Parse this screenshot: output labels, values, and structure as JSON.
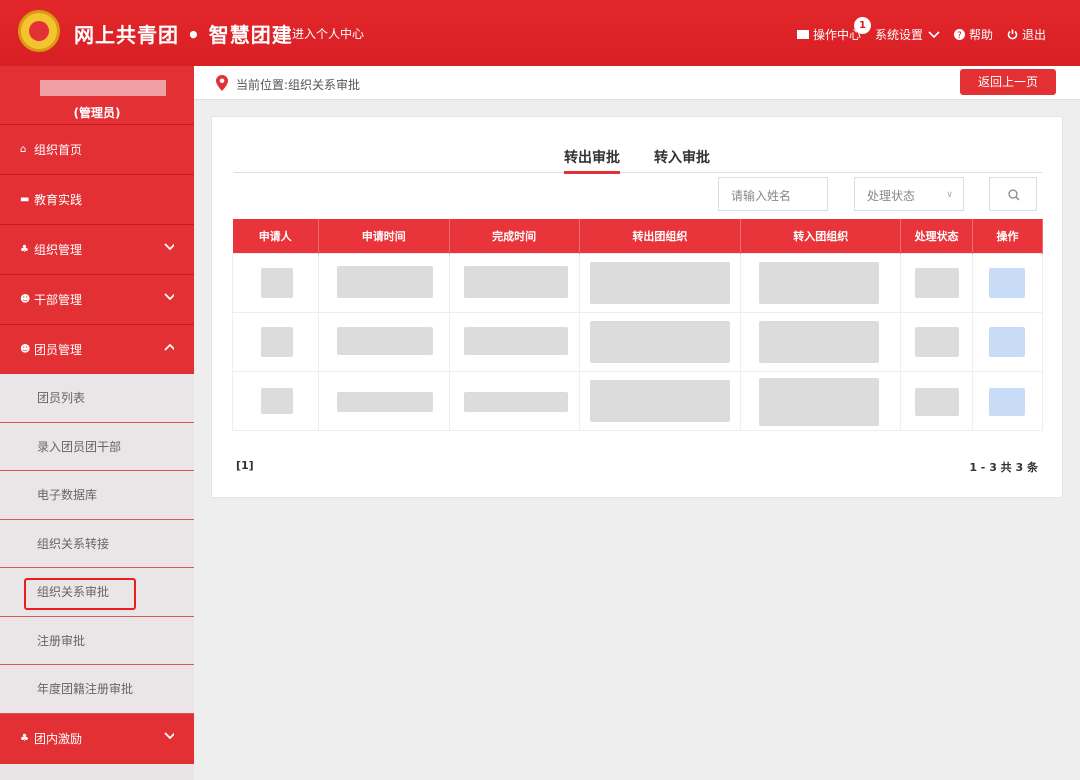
{
  "header": {
    "title": "网上共青团 • 智慧团建",
    "personal_center": "进入个人中心",
    "ops_center": "操作中心",
    "ops_badge": "1",
    "settings": "系统设置",
    "help": "帮助",
    "logout": "退出"
  },
  "sidebar": {
    "role": "(管理员)",
    "items": [
      {
        "label": "组织首页",
        "icon": "home-icon"
      },
      {
        "label": "教育实践",
        "icon": "folder-icon"
      },
      {
        "label": "组织管理",
        "icon": "org-icon"
      },
      {
        "label": "干部管理",
        "icon": "users-icon"
      },
      {
        "label": "团员管理",
        "icon": "users-icon"
      }
    ],
    "sub_items": [
      "团员列表",
      "录入团员团干部",
      "电子数据库",
      "组织关系转接",
      "组织关系审批",
      "注册审批",
      "年度团籍注册审批"
    ],
    "bottom_item": {
      "label": "团内激励",
      "icon": "org-icon"
    }
  },
  "breadcrumb": {
    "text": "当前位置:组织关系审批",
    "back_label": "返回上一页"
  },
  "main": {
    "tabs": [
      "转出审批",
      "转入审批"
    ],
    "search_placeholder": "请输入姓名",
    "status_filter": "处理状态",
    "columns": [
      "申请人",
      "申请时间",
      "完成时间",
      "转出团组织",
      "转入团组织",
      "处理状态",
      "操作"
    ],
    "pager": "[1]",
    "count_text": "1 - 3   共 3 条"
  },
  "colors": {
    "accent": "#e23035",
    "highlight_box": "#e8201d"
  }
}
